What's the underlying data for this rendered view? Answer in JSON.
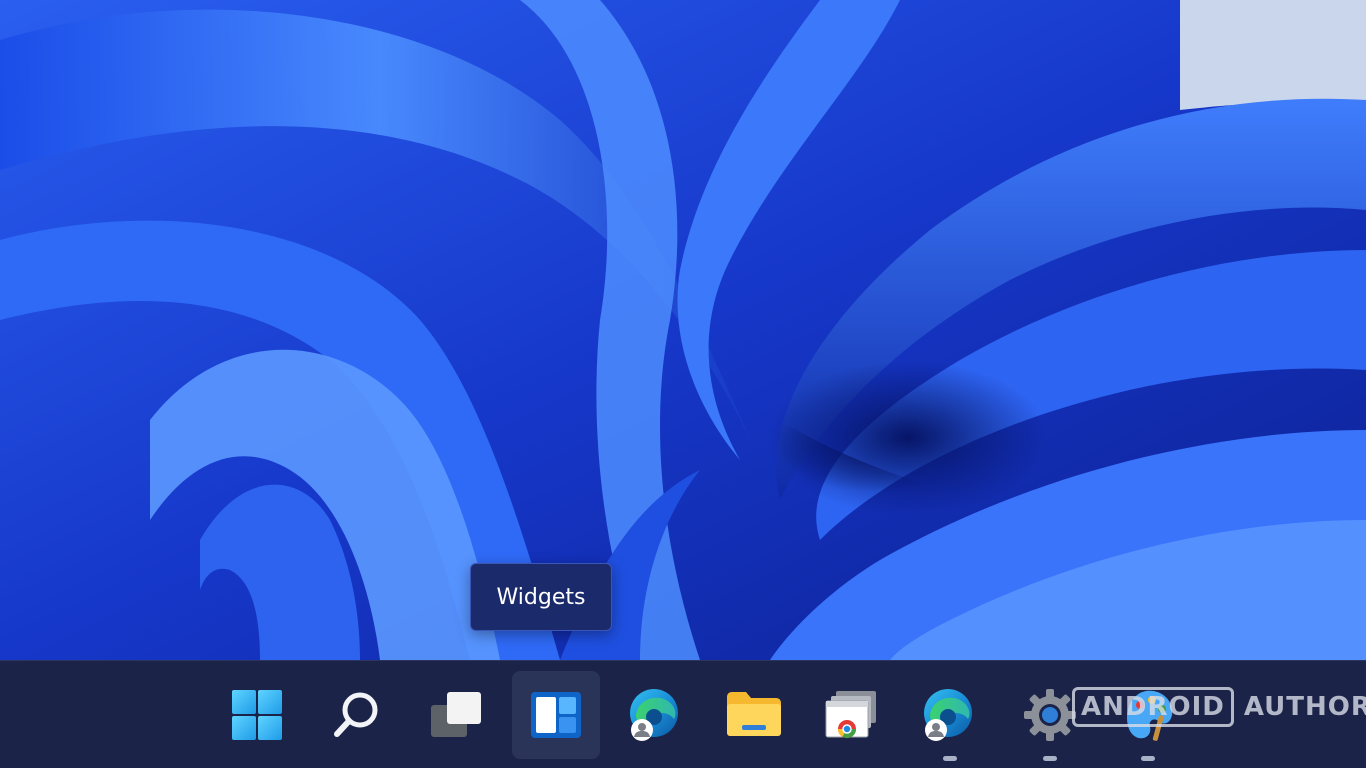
{
  "tooltip": {
    "text": "Widgets"
  },
  "taskbar": {
    "items": [
      {
        "name": "start",
        "icon": "windows-logo-icon",
        "active": false,
        "running": false
      },
      {
        "name": "search",
        "icon": "search-icon",
        "active": false,
        "running": false
      },
      {
        "name": "task-view",
        "icon": "task-view-icon",
        "active": false,
        "running": false
      },
      {
        "name": "widgets",
        "icon": "widgets-icon",
        "active": true,
        "running": false
      },
      {
        "name": "edge",
        "icon": "edge-icon",
        "active": false,
        "running": false
      },
      {
        "name": "file-explorer",
        "icon": "folder-icon",
        "active": false,
        "running": false
      },
      {
        "name": "chrome-app",
        "icon": "chrome-window-icon",
        "active": false,
        "running": false
      },
      {
        "name": "edge-2",
        "icon": "edge-icon",
        "active": false,
        "running": true
      },
      {
        "name": "settings",
        "icon": "gear-icon",
        "active": false,
        "running": true
      },
      {
        "name": "paint",
        "icon": "paint-icon",
        "active": false,
        "running": true
      }
    ]
  },
  "watermark": {
    "boxed": "ANDROID",
    "text": "AUTHORITY"
  },
  "colors": {
    "wallpaper": "#1a3fd6",
    "taskbar": "#1b2448",
    "tooltip_bg": "#1b2a6b",
    "accent": "#4cc2ff"
  }
}
